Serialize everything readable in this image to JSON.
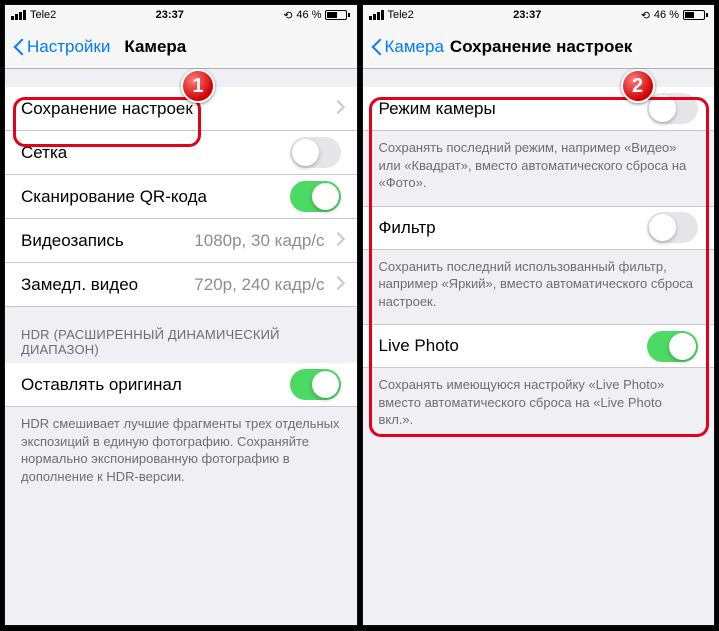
{
  "status": {
    "carrier": "Tele2",
    "time": "23:37",
    "battery_pct": "46 %"
  },
  "left": {
    "back_label": "Настройки",
    "title": "Камера",
    "rows": {
      "preserve": "Сохранение настроек",
      "grid": "Сетка",
      "qr": "Сканирование QR-кода",
      "video": "Видеозапись",
      "video_val": "1080p, 30 кадр/с",
      "slomo": "Замедл. видео",
      "slomo_val": "720p, 240 кадр/с"
    },
    "hdr_header": "HDR (РАСШИРЕННЫЙ ДИНАМИЧЕСКИЙ ДИАПАЗОН)",
    "hdr_keep": "Оставлять оригинал",
    "hdr_footer": "HDR смешивает лучшие фрагменты трех отдельных экспозиций в единую фотографию. Сохраняйте нормально экспонированную фотографию в дополнение к HDR-версии.",
    "step": "1"
  },
  "right": {
    "back_label": "Камера",
    "title": "Сохранение настроек",
    "rows": {
      "mode": "Режим камеры",
      "mode_footer": "Сохранять последний режим, например «Видео» или «Квадрат», вместо автоматического сброса на «Фото».",
      "filter": "Фильтр",
      "filter_footer": "Сохранить последний использованный фильтр, например «Яркий», вместо автоматического сброса настроек.",
      "live": "Live Photo",
      "live_footer": "Сохранять имеющуюся настройку «Live Photo» вместо автоматического сброса на «Live Photo вкл.»."
    },
    "step": "2"
  }
}
